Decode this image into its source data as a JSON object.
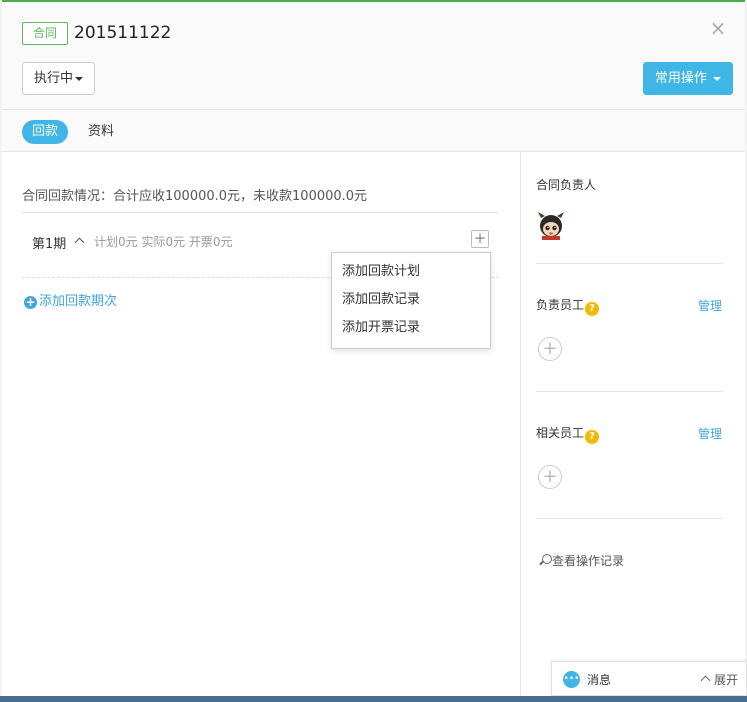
{
  "header": {
    "tag": "合同",
    "contract_no": "201511122",
    "close_label": "×",
    "status_label": "执行中",
    "ops_label": "常用操作"
  },
  "tabs": [
    {
      "label": "回款",
      "active": true
    },
    {
      "label": "资料",
      "active": false
    }
  ],
  "main": {
    "summary": "合同回款情况：合计应收100000.0元，未收款100000.0元",
    "period": {
      "name": "第1期",
      "stats": "计划0元 实际0元 开票0元",
      "add_symbol": "+"
    },
    "add_period_label": "添加回款期次",
    "add_period_symbol": "+"
  },
  "menu": {
    "items": [
      "添加回款计划",
      "添加回款记录",
      "添加开票记录"
    ]
  },
  "side": {
    "owner_title": "合同负责人",
    "responsible_title": "负责员工",
    "responsible_manage": "管理",
    "related_title": "相关员工",
    "related_manage": "管理",
    "help_symbol": "?",
    "add_symbol": "+",
    "log_label": "查看操作记录"
  },
  "message_bar": {
    "label": "消息",
    "expand_label": "展开"
  },
  "colors": {
    "accent": "#3fb6e6",
    "tag_green": "#5cb85c",
    "link_blue": "#3fa4de",
    "help_yellow": "#f5b800"
  }
}
